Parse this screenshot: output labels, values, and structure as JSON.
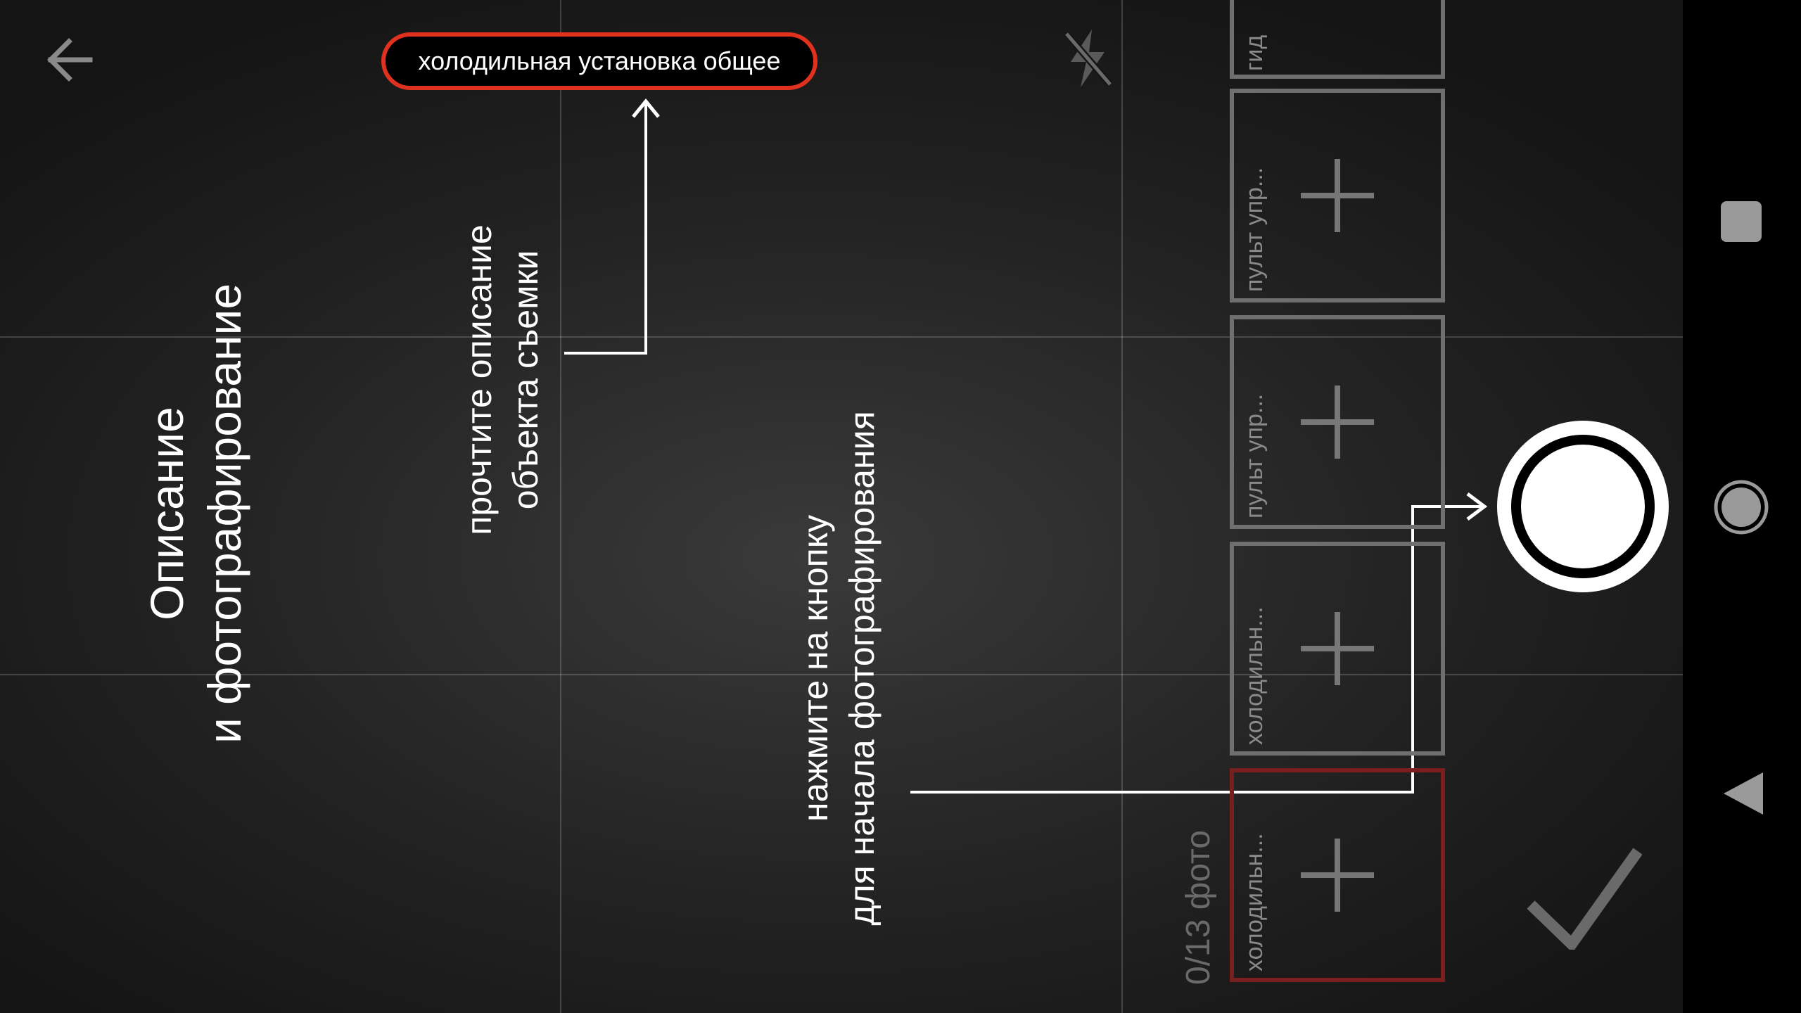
{
  "header": {
    "back_icon": "arrow-left-icon",
    "description_text": "холодильная установка общее",
    "flash_icon": "flash-off-icon"
  },
  "title": {
    "line1": "Описание",
    "line2": "и фотографирование"
  },
  "hints": {
    "read_line1": "прочтите описание",
    "read_line2": "объекта съемки",
    "press_line1": "нажмите на кнопку",
    "press_line2": "для начала фотографирования"
  },
  "photos": {
    "counter": "0/13 фото",
    "items": [
      {
        "label": "гид"
      },
      {
        "label": "пульт упр..."
      },
      {
        "label": "пульт упр..."
      },
      {
        "label": "холодильн..."
      },
      {
        "label": "холодильн..."
      }
    ]
  },
  "controls": {
    "shutter_icon": "shutter-button-icon",
    "confirm_icon": "checkmark-icon"
  },
  "navbar": {
    "recents_icon": "square-icon",
    "home_icon": "circle-icon",
    "back_icon": "triangle-back-icon"
  },
  "colors": {
    "highlight": "#e0301e",
    "active_thumb": "#7a1f1f"
  }
}
